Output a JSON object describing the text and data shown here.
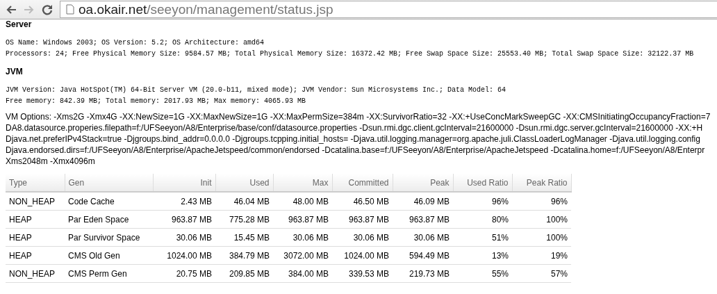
{
  "browser": {
    "url_host": "oa.okair.net",
    "url_path": "/seeyon/management/status.jsp"
  },
  "server": {
    "heading": "Server",
    "lines": [
      "OS Name: Windows 2003; OS Version: 5.2; OS Architecture: amd64",
      "Processors: 24; Free Physical Memory Size: 9584.57 MB; Total Physical Memory Size: 16372.42 MB; Free Swap Space Size: 25553.40 MB; Total Swap Space Size: 32122.37 MB"
    ]
  },
  "jvm": {
    "heading": "JVM",
    "lines": [
      "JVM Version: Java HotSpot(TM) 64-Bit Server VM (20.0-b11, mixed mode); JVM Vendor: Sun Microsystems Inc.; Data Model: 64",
      "Free memory: 842.39 MB; Total memory: 2017.93 MB; Max memory: 4065.93 MB"
    ],
    "vm_options": [
      "VM Options: -Xms2G -Xmx4G -XX:NewSize=1G -XX:MaxNewSize=1G -XX:MaxPermSize=384m -XX:SurvivorRatio=32 -XX:+UseConcMarkSweepGC -XX:CMSInitiatingOccupancyFraction=7",
      "DA8.datasource.properies.filepath=f:/UFSeeyon/A8/Enterprise/base/conf/datasource.properties -Dsun.rmi.dgc.client.gcInterval=21600000 -Dsun.rmi.dgc.server.gcInterval=21600000 -XX:+H",
      "Djava.net.preferIPv4Stack=true -Djgroups.bind_addr=0.0.0.0 -Djgroups.tcpping.initial_hosts= -Djava.util.logging.manager=org.apache.juli.ClassLoaderLogManager -Djava.util.logging.config",
      "Djava.endorsed.dirs=f:/UFSeeyon/A8/Enterprise/ApacheJetspeed/common/endorsed -Dcatalina.base=f:/UFSeeyon/A8/Enterprise/ApacheJetspeed -Dcatalina.home=f:/UFSeeyon/A8/Enterpr",
      "Xms2048m -Xmx4096m"
    ]
  },
  "table": {
    "columns": [
      "Type",
      "Gen",
      "Init",
      "Used",
      "Max",
      "Committed",
      "Peak",
      "Used Ratio",
      "Peak Ratio"
    ],
    "rows": [
      [
        "NON_HEAP",
        "Code Cache",
        "2.43 MB",
        "46.04 MB",
        "48.00 MB",
        "46.50 MB",
        "46.09 MB",
        "96%",
        "96%"
      ],
      [
        "HEAP",
        "Par Eden Space",
        "963.87 MB",
        "775.28 MB",
        "963.87 MB",
        "963.87 MB",
        "963.87 MB",
        "80%",
        "100%"
      ],
      [
        "HEAP",
        "Par Survivor Space",
        "30.06 MB",
        "15.45 MB",
        "30.06 MB",
        "30.06 MB",
        "30.06 MB",
        "51%",
        "100%"
      ],
      [
        "HEAP",
        "CMS Old Gen",
        "1024.00 MB",
        "384.79 MB",
        "3072.00 MB",
        "1024.00 MB",
        "594.49 MB",
        "13%",
        "19%"
      ],
      [
        "NON_HEAP",
        "CMS Perm Gen",
        "20.75 MB",
        "209.85 MB",
        "384.00 MB",
        "339.53 MB",
        "219.73 MB",
        "55%",
        "57%"
      ]
    ]
  }
}
